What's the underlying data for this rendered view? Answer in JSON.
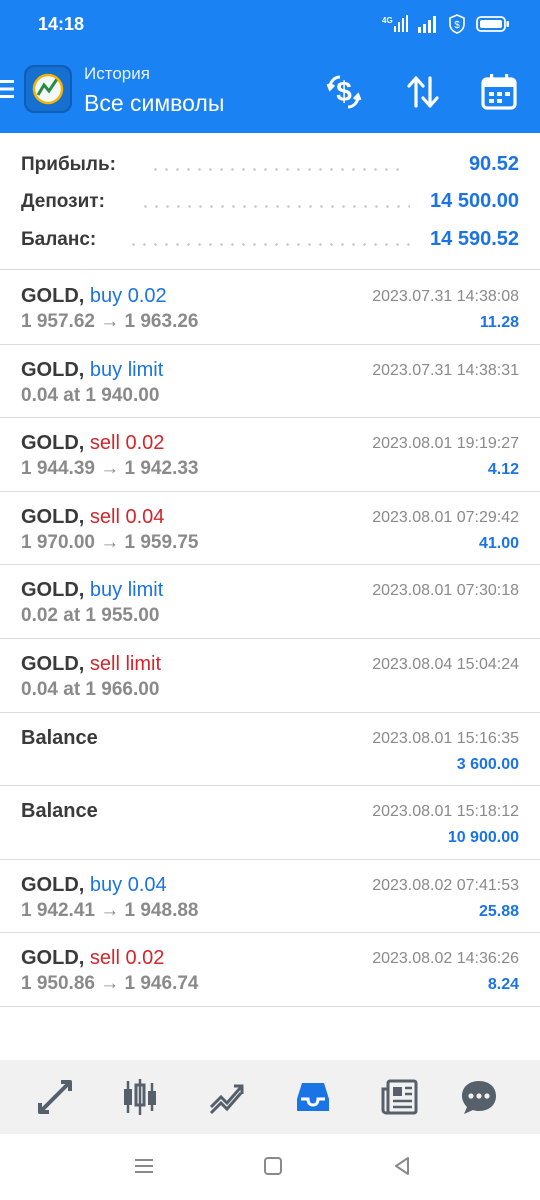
{
  "status": {
    "time": "14:18",
    "network": "4G"
  },
  "header": {
    "subtitle": "История",
    "title": "Все символы"
  },
  "summary": [
    {
      "label": "Прибыль:",
      "value": "90.52"
    },
    {
      "label": "Депозит:",
      "value": "14 500.00"
    },
    {
      "label": "Баланс:",
      "value": "14 590.52"
    }
  ],
  "trades": [
    {
      "symbol": "GOLD,",
      "op": "buy 0.02",
      "side": "buy",
      "prices": "1 957.62 → 1 963.26",
      "time": "2023.07.31 14:38:08",
      "profit": "11.28"
    },
    {
      "symbol": "GOLD,",
      "op": "buy limit",
      "side": "buy",
      "prices": "0.04 at 1 940.00",
      "time": "2023.07.31 14:38:31",
      "profit": ""
    },
    {
      "symbol": "GOLD,",
      "op": "sell 0.02",
      "side": "sell",
      "prices": "1 944.39 → 1 942.33",
      "time": "2023.08.01 19:19:27",
      "profit": "4.12"
    },
    {
      "symbol": "GOLD,",
      "op": "sell 0.04",
      "side": "sell",
      "prices": "1 970.00 → 1 959.75",
      "time": "2023.08.01 07:29:42",
      "profit": "41.00"
    },
    {
      "symbol": "GOLD,",
      "op": "buy limit",
      "side": "buy",
      "prices": "0.02 at 1 955.00",
      "time": "2023.08.01 07:30:18",
      "profit": ""
    },
    {
      "symbol": "GOLD,",
      "op": "sell limit",
      "side": "sell",
      "prices": "0.04 at 1 966.00",
      "time": "2023.08.04 15:04:24",
      "profit": ""
    },
    {
      "symbol": "Balance",
      "op": "",
      "side": "",
      "prices": "",
      "time": "2023.08.01 15:16:35",
      "profit": "3 600.00"
    },
    {
      "symbol": "Balance",
      "op": "",
      "side": "",
      "prices": "",
      "time": "2023.08.01 15:18:12",
      "profit": "10 900.00"
    },
    {
      "symbol": "GOLD,",
      "op": "buy 0.04",
      "side": "buy",
      "prices": "1 942.41 → 1 948.88",
      "time": "2023.08.02 07:41:53",
      "profit": "25.88"
    },
    {
      "symbol": "GOLD,",
      "op": "sell 0.02",
      "side": "sell",
      "prices": "1 950.86 → 1 946.74",
      "time": "2023.08.02 14:36:26",
      "profit": "8.24"
    }
  ],
  "toolbar_icons": [
    "currency-exchange-icon",
    "sort-icon",
    "calendar-icon"
  ],
  "bottom_nav": [
    {
      "name": "quotes-icon",
      "active": false
    },
    {
      "name": "chart-icon",
      "active": false
    },
    {
      "name": "trade-icon",
      "active": false
    },
    {
      "name": "history-icon",
      "active": true
    },
    {
      "name": "news-icon",
      "active": false
    },
    {
      "name": "chat-icon",
      "active": false
    }
  ],
  "colors": {
    "accent": "#1b82f3",
    "buy": "#1b74e6",
    "sell": "#d3262b",
    "nav_inactive": "#55606b"
  }
}
